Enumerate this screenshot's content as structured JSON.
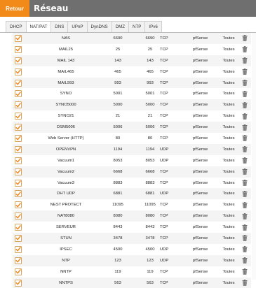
{
  "header": {
    "back_label": "Retour",
    "title": "Réseau"
  },
  "tabs": [
    {
      "label": "DHCP"
    },
    {
      "label": "NAT/PAT"
    },
    {
      "label": "DNS"
    },
    {
      "label": "UPnP"
    },
    {
      "label": "DynDNS"
    },
    {
      "label": "DMZ"
    },
    {
      "label": "NTP"
    },
    {
      "label": "IPv6"
    }
  ],
  "active_tab": "NAT/PAT",
  "colors": {
    "accent": "#f28a1a",
    "header_bg": "#6f6f6f",
    "checkbox_check": "#f28a1a"
  },
  "rules": [
    {
      "name": "NAS",
      "ext_port": "6690",
      "int_port": "6690",
      "protocol": "TCP",
      "device": "pfSense",
      "iface": "Toutes",
      "enabled": true
    },
    {
      "name": "MAIL25",
      "ext_port": "25",
      "int_port": "25",
      "protocol": "TCP",
      "device": "pfSense",
      "iface": "Toutes",
      "enabled": true
    },
    {
      "name": "MAIL 143",
      "ext_port": "143",
      "int_port": "143",
      "protocol": "TCP",
      "device": "pfSense",
      "iface": "Toutes",
      "enabled": true
    },
    {
      "name": "MAIL465",
      "ext_port": "465",
      "int_port": "465",
      "protocol": "TCP",
      "device": "pfSense",
      "iface": "Toutes",
      "enabled": true
    },
    {
      "name": "MAIL993",
      "ext_port": "993",
      "int_port": "993",
      "protocol": "TCP",
      "device": "pfSense",
      "iface": "Toutes",
      "enabled": true
    },
    {
      "name": "SYNO",
      "ext_port": "5001",
      "int_port": "5001",
      "protocol": "TCP",
      "device": "pfSense",
      "iface": "Toutes",
      "enabled": true
    },
    {
      "name": "SYNO5000",
      "ext_port": "5000",
      "int_port": "5000",
      "protocol": "TCP",
      "device": "pfSense",
      "iface": "Toutes",
      "enabled": true
    },
    {
      "name": "SYNO21",
      "ext_port": "21",
      "int_port": "21",
      "protocol": "TCP",
      "device": "pfSense",
      "iface": "Toutes",
      "enabled": true
    },
    {
      "name": "DSM5006",
      "ext_port": "5006",
      "int_port": "5006",
      "protocol": "TCP",
      "device": "pfSense",
      "iface": "Toutes",
      "enabled": true
    },
    {
      "name": "Web Server (HTTP)",
      "ext_port": "80",
      "int_port": "80",
      "protocol": "TCP",
      "device": "pfSense",
      "iface": "Toutes",
      "enabled": true
    },
    {
      "name": "OPENVPN",
      "ext_port": "1194",
      "int_port": "1194",
      "protocol": "UDP",
      "device": "pfSense",
      "iface": "Toutes",
      "enabled": true
    },
    {
      "name": "Vacuum1",
      "ext_port": "8053",
      "int_port": "8053",
      "protocol": "UDP",
      "device": "pfSense",
      "iface": "Toutes",
      "enabled": true
    },
    {
      "name": "Vacuum2",
      "ext_port": "6668",
      "int_port": "6668",
      "protocol": "TCP",
      "device": "pfSense",
      "iface": "Toutes",
      "enabled": true
    },
    {
      "name": "Vacuum3",
      "ext_port": "8883",
      "int_port": "8883",
      "protocol": "TCP",
      "device": "pfSense",
      "iface": "Toutes",
      "enabled": true
    },
    {
      "name": "DHT UDP",
      "ext_port": "6881",
      "int_port": "6881",
      "protocol": "UDP",
      "device": "pfSense",
      "iface": "Toutes",
      "enabled": true
    },
    {
      "name": "NEST PROTECT",
      "ext_port": "11095",
      "int_port": "11095",
      "protocol": "TCP",
      "device": "pfSense",
      "iface": "Toutes",
      "enabled": true
    },
    {
      "name": "NAT8080",
      "ext_port": "8080",
      "int_port": "8080",
      "protocol": "TCP",
      "device": "pfSense",
      "iface": "Toutes",
      "enabled": true
    },
    {
      "name": "SERVEUR",
      "ext_port": "8443",
      "int_port": "8443",
      "protocol": "TCP",
      "device": "pfSense",
      "iface": "Toutes",
      "enabled": true
    },
    {
      "name": "STUN",
      "ext_port": "3478",
      "int_port": "3478",
      "protocol": "TCP",
      "device": "pfSense",
      "iface": "Toutes",
      "enabled": true
    },
    {
      "name": "IPSEC",
      "ext_port": "4500",
      "int_port": "4500",
      "protocol": "UDP",
      "device": "pfSense",
      "iface": "Toutes",
      "enabled": true
    },
    {
      "name": "NTP",
      "ext_port": "123",
      "int_port": "123",
      "protocol": "UDP",
      "device": "pfSense",
      "iface": "Toutes",
      "enabled": true
    },
    {
      "name": "NNTP",
      "ext_port": "119",
      "int_port": "119",
      "protocol": "TCP",
      "device": "pfSense",
      "iface": "Toutes",
      "enabled": true
    },
    {
      "name": "NNTPS",
      "ext_port": "563",
      "int_port": "563",
      "protocol": "TCP",
      "device": "pfSense",
      "iface": "Toutes",
      "enabled": true
    }
  ],
  "icons": {
    "check": "check-icon",
    "delete": "trash-icon"
  }
}
